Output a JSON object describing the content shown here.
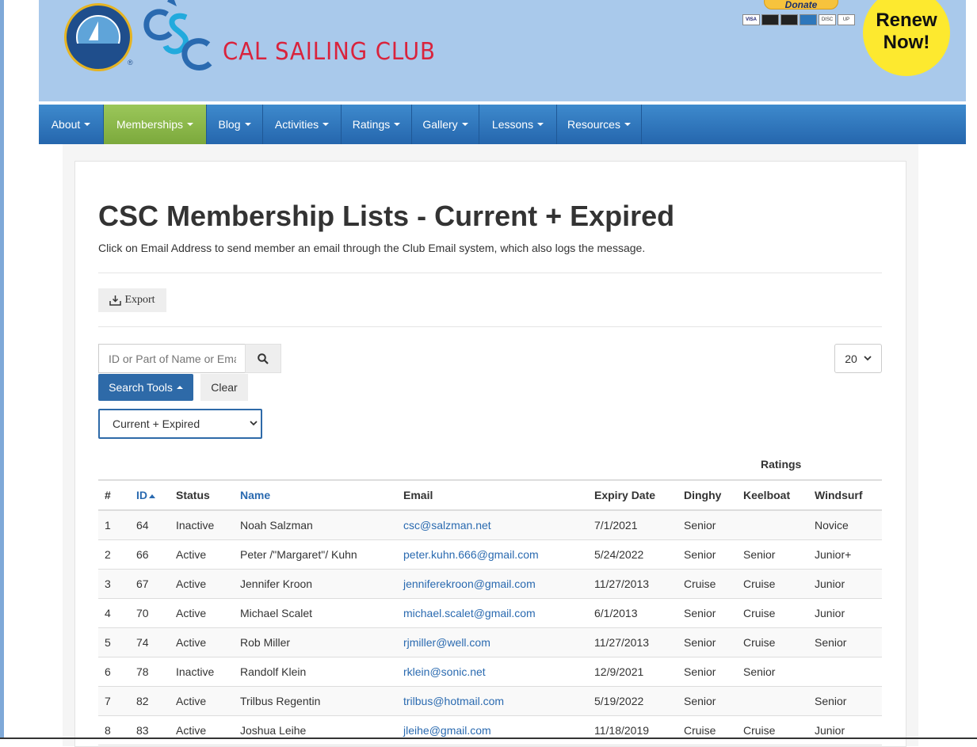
{
  "header": {
    "seal_mark": "®",
    "club_name": "CAL SAILING CLUB",
    "donate_label": "Donate",
    "cards": [
      "VISA",
      "",
      "",
      "",
      "DISC",
      "UP"
    ],
    "renew_line1": "Renew",
    "renew_line2": "Now!"
  },
  "nav": {
    "items": [
      {
        "label": "About"
      },
      {
        "label": "Memberships"
      },
      {
        "label": "Blog"
      },
      {
        "label": "Activities"
      },
      {
        "label": "Ratings"
      },
      {
        "label": "Gallery"
      },
      {
        "label": "Lessons"
      },
      {
        "label": "Resources"
      }
    ]
  },
  "page": {
    "title": "CSC Membership Lists - Current + Expired",
    "subtitle": "Click on Email Address to send member an email through the Club Email system, which also logs the message.",
    "export_label": "Export"
  },
  "search": {
    "placeholder": "ID or Part of Name or Email",
    "tools_label": "Search Tools",
    "clear_label": "Clear",
    "per_page": "20",
    "filter": "Current + Expired"
  },
  "table": {
    "group_header": "Ratings",
    "headers": [
      "#",
      "ID",
      "Status",
      "Name",
      "Email",
      "Expiry Date",
      "Dinghy",
      "Keelboat",
      "Windsurf"
    ],
    "rows": [
      [
        "1",
        "64",
        "Inactive",
        "Noah Salzman",
        "csc@salzman.net",
        "7/1/2021",
        "Senior",
        "",
        "Novice"
      ],
      [
        "2",
        "66",
        "Active",
        "Peter /\"Margaret\"/ Kuhn",
        "peter.kuhn.666@gmail.com",
        "5/24/2022",
        "Senior",
        "Senior",
        "Junior+"
      ],
      [
        "3",
        "67",
        "Active",
        "Jennifer Kroon",
        "jenniferekroon@gmail.com",
        "11/27/2013",
        "Cruise",
        "Cruise",
        "Junior"
      ],
      [
        "4",
        "70",
        "Active",
        "Michael Scalet",
        "michael.scalet@gmail.com",
        "6/1/2013",
        "Senior",
        "Cruise",
        "Junior"
      ],
      [
        "5",
        "74",
        "Active",
        "Rob Miller",
        "rjmiller@well.com",
        "11/27/2013",
        "Senior",
        "Cruise",
        "Senior"
      ],
      [
        "6",
        "78",
        "Inactive",
        "Randolf Klein",
        "rklein@sonic.net",
        "12/9/2021",
        "Senior",
        "Senior",
        ""
      ],
      [
        "7",
        "82",
        "Active",
        "Trilbus Regentin",
        "trilbus@hotmail.com",
        "5/19/2022",
        "Senior",
        "",
        "Senior"
      ],
      [
        "8",
        "83",
        "Active",
        "Joshua Leihe",
        "jleihe@gmail.com",
        "11/18/2019",
        "Cruise",
        "Cruise",
        "Junior"
      ]
    ]
  },
  "colors": {
    "nav_blue": "#2e6aa8",
    "nav_active_green": "#8bb84a",
    "header_bg": "#a9c9eb",
    "club_red": "#d9233c",
    "renew_yellow": "#fde92f",
    "link_blue": "#2a6ab0"
  }
}
